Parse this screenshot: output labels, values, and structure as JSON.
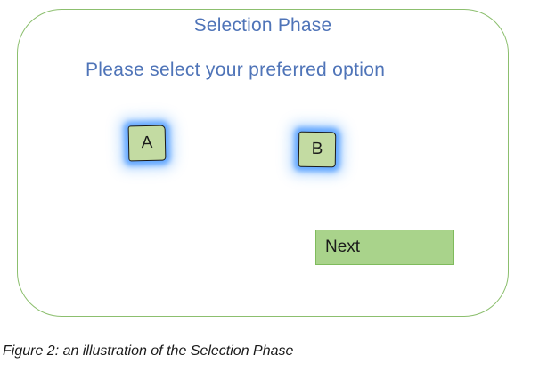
{
  "screen": {
    "title": "Selection Phase",
    "prompt": "Please select your preferred option",
    "options": [
      {
        "label": "A"
      },
      {
        "label": "B"
      }
    ],
    "next_label": "Next"
  },
  "caption": "Figure 2: an illustration of the Selection Phase",
  "colors": {
    "frame_border": "#8cbf6e",
    "heading_text": "#4f74b8",
    "option_fill": "#c3dba2",
    "option_glow": "#4696ff",
    "next_fill": "#a9d38b"
  }
}
